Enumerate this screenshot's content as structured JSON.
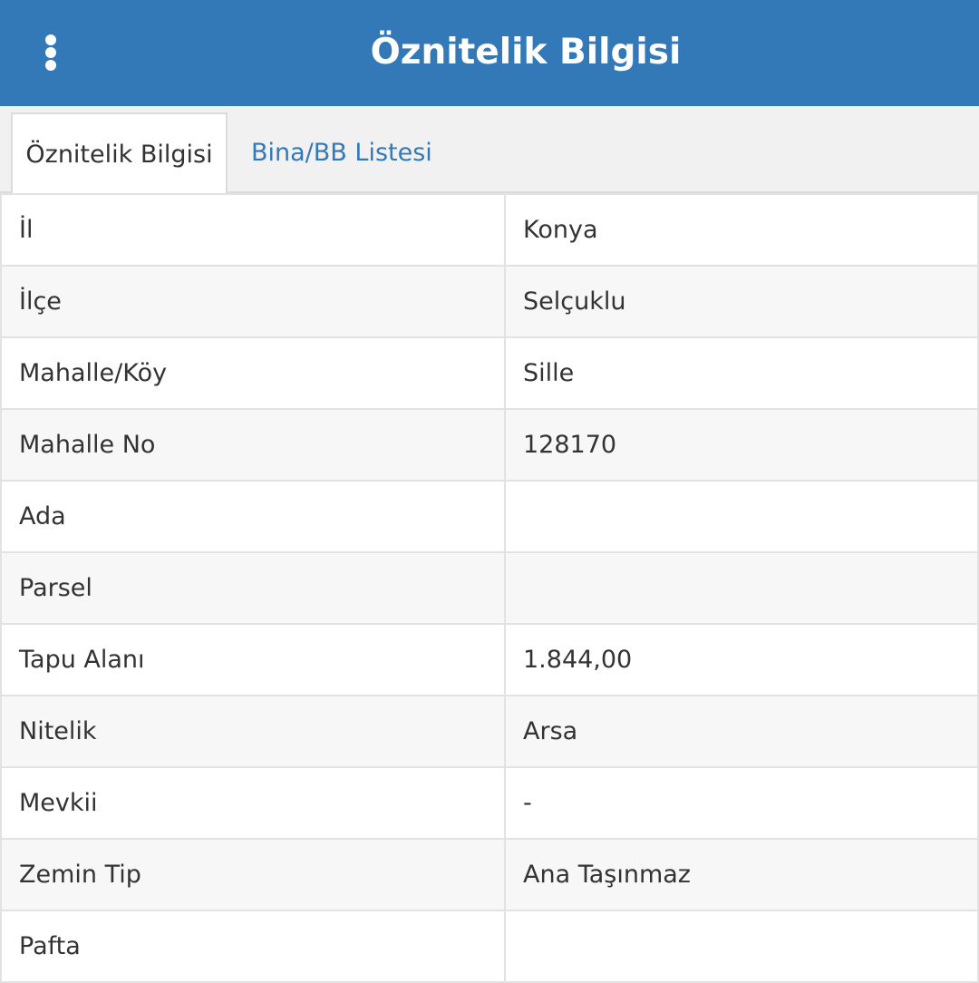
{
  "header": {
    "title": "Öznitelik Bilgisi",
    "menu_icon": "more-vertical-icon",
    "background": "#3379b7"
  },
  "tabs": [
    {
      "label": "Öznitelik Bilgisi",
      "active": true
    },
    {
      "label": "Bina/BB Listesi",
      "active": false
    }
  ],
  "rows": [
    {
      "label": "İl",
      "value": "Konya"
    },
    {
      "label": "İlçe",
      "value": "Selçuklu"
    },
    {
      "label": "Mahalle/Köy",
      "value": "Sille"
    },
    {
      "label": "Mahalle No",
      "value": "128170"
    },
    {
      "label": "Ada",
      "value": ""
    },
    {
      "label": "Parsel",
      "value": ""
    },
    {
      "label": "Tapu Alanı",
      "value": "1.844,00"
    },
    {
      "label": "Nitelik",
      "value": "Arsa"
    },
    {
      "label": "Mevkii",
      "value": "-"
    },
    {
      "label": "Zemin Tip",
      "value": "Ana Taşınmaz"
    },
    {
      "label": "Pafta",
      "value": ""
    }
  ]
}
